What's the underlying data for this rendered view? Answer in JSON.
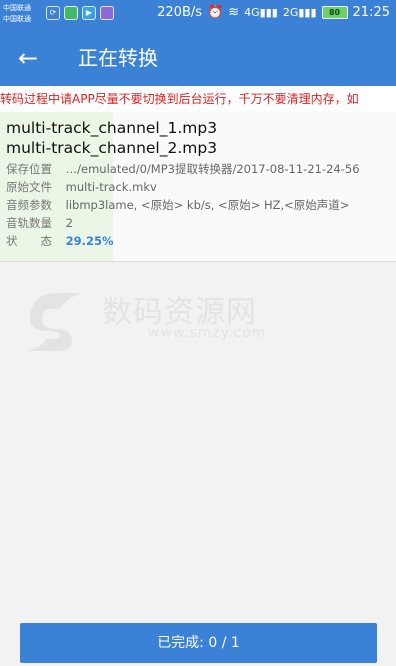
{
  "status_bar": {
    "carrier_1": "中国联通",
    "carrier_2": "中国联通",
    "speed": "220B/s",
    "net_4g": "4G",
    "net_2g": "2G",
    "battery": "80",
    "time": "21:25"
  },
  "appbar": {
    "back_icon": "arrow-left-icon",
    "title": "正在转换"
  },
  "warning": "转码过程中请APP尽量不要切换到后台运行，千万不要清理内存，如",
  "task": {
    "files": [
      "multi-track_channel_1.mp3",
      "multi-track_channel_2.mp3"
    ],
    "rows": [
      {
        "key": "保存位置",
        "value": "…/emulated/0/MP3提取转换器/2017-08-11-21-24-56"
      },
      {
        "key": "原始文件",
        "value": "multi-track.mkv"
      },
      {
        "key": "音频参数",
        "value": "libmp3lame, <原始> kb/s, <原始> HZ,<原始声道>"
      },
      {
        "key": "音轨数量",
        "value": "2"
      },
      {
        "key": "状　　态",
        "value": "29.25%"
      }
    ]
  },
  "watermark": {
    "text": "数码资源网",
    "url": "www.smzy.com"
  },
  "done_button": "已完成: 0 / 1"
}
